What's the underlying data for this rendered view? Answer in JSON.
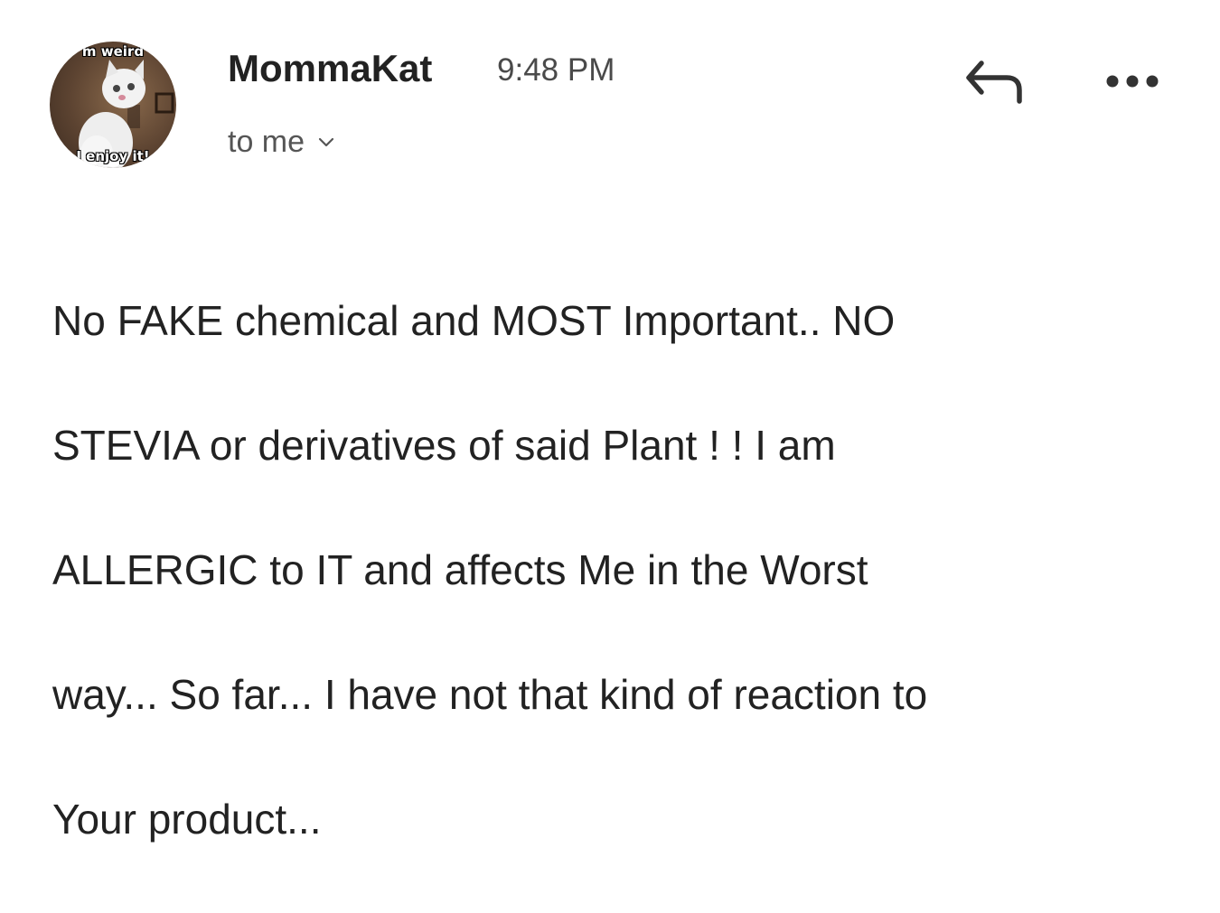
{
  "avatar": {
    "caption_top": "m weird",
    "caption_bottom": "I enjoy it!"
  },
  "header": {
    "sender": "MommaKat",
    "time": "9:48 PM",
    "recipient_label": "to me"
  },
  "icons": {
    "reply": "reply-arrow-icon",
    "more": "more-horizontal-icon",
    "chevron": "chevron-down-icon"
  },
  "message": {
    "lines": [
      "No FAKE chemical and MOST Important.. NO",
      "STEVIA or derivatives of said Plant  ! ! I am",
      "ALLERGIC to IT and affects Me in the Worst",
      "way... So far... I have not that kind of reaction to",
      "Your product..."
    ]
  }
}
